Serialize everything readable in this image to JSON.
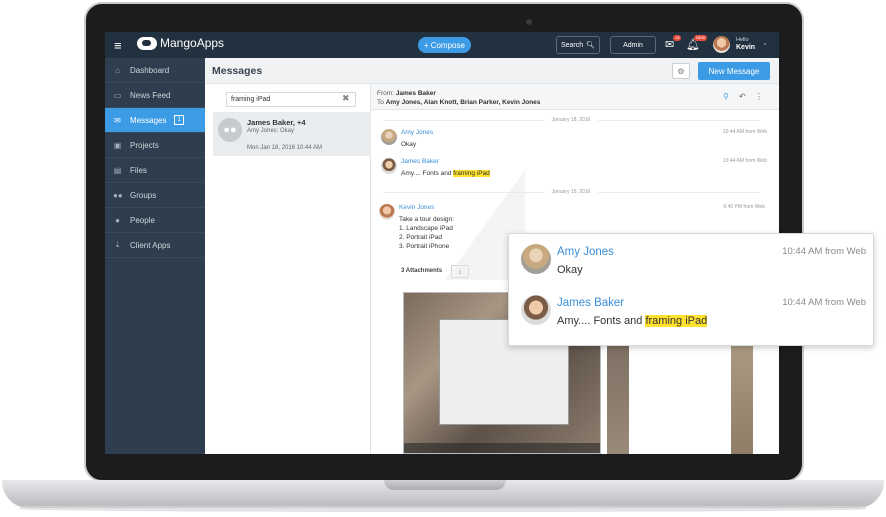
{
  "topbar": {
    "app_name": "MangoApps",
    "compose_label": "Compose",
    "search_label": "Search",
    "admin_label": "Admin",
    "chat_badge": "13",
    "notif_badge": "NEW",
    "hello": "Hello",
    "user_name": "Kevin"
  },
  "sidebar": {
    "items": [
      {
        "label": "Dashboard",
        "icon": "home-icon"
      },
      {
        "label": "News Feed",
        "icon": "inbox-icon"
      },
      {
        "label": "Messages",
        "icon": "envelope-icon",
        "count": "1"
      },
      {
        "label": "Projects",
        "icon": "briefcase-icon"
      },
      {
        "label": "Files",
        "icon": "file-icon"
      },
      {
        "label": "Groups",
        "icon": "group-icon"
      },
      {
        "label": "People",
        "icon": "person-icon"
      },
      {
        "label": "Client Apps",
        "icon": "download-icon"
      }
    ]
  },
  "main": {
    "title": "Messages",
    "new_message_label": "New Message"
  },
  "list": {
    "search_value": "framing iPad",
    "conversation": {
      "name": "James Baker, +4",
      "preview": "Amy Jones: Okay",
      "date": "Mon Jan 18, 2016 10:44 AM"
    }
  },
  "thread": {
    "from_label": "From:",
    "from_name": "James Baker",
    "to_label": "To",
    "to_names": "Amy Jones, Alan Knott, Brian Parker, Kevin Jones",
    "date_sep_1": "January 18, 2016",
    "date_sep_2": "January 15, 2016",
    "messages": [
      {
        "name": "Amy Jones",
        "time": "10:44 AM from Web",
        "text": "Okay"
      },
      {
        "name": "James Baker",
        "time": "10:44 AM from Web",
        "text_before": "Amy.... Fonts and ",
        "highlight": "framing iPad"
      },
      {
        "name": "Kevin Jones",
        "time": "6:45 PM from Web",
        "text": "Take a tour design:\n1. Landscape iPad\n2. Portrait iPad\n3. Portrait iPhone"
      }
    ],
    "attachments_label": "3 Attachments"
  },
  "zoom": {
    "messages": [
      {
        "name": "Amy Jones",
        "time": "10:44 AM from Web",
        "text": "Okay"
      },
      {
        "name": "James Baker",
        "time": "10:44 AM from Web",
        "text_before": "Amy.... Fonts and ",
        "highlight": "framing iPad"
      }
    ]
  }
}
